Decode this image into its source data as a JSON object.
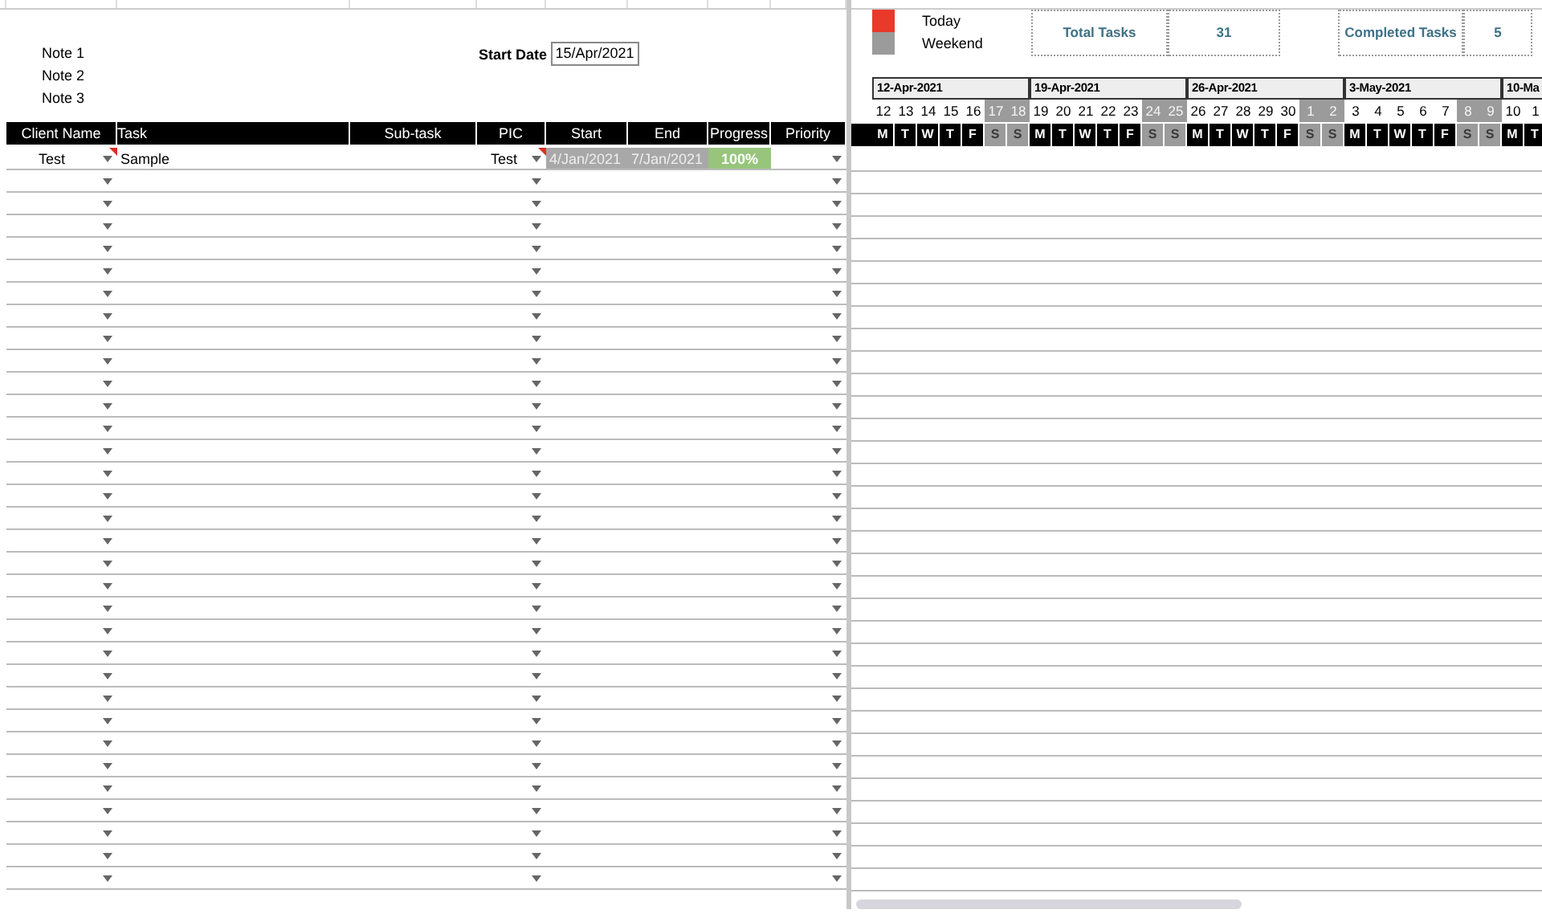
{
  "notes": [
    "Note 1",
    "Note 2",
    "Note 3"
  ],
  "start_date": {
    "label": "Start Date",
    "value": "15/Apr/2021"
  },
  "legend": [
    {
      "label": "Today",
      "color": "#e8392b"
    },
    {
      "label": "Weekend",
      "color": "#9b9b9b"
    }
  ],
  "stats": [
    {
      "label": "Total Tasks",
      "value": "31"
    },
    {
      "label": "Completed Tasks",
      "value": "5"
    }
  ],
  "table": {
    "columns": [
      "Client Name",
      "Task",
      "Sub-task",
      "PIC",
      "Start",
      "End",
      "Progress",
      "Priority"
    ],
    "rows": [
      {
        "kind": "task",
        "client": "Test",
        "client_note": true,
        "task": "Sample",
        "pic": "Test",
        "pic_note": true,
        "start": "4/Jan/2021",
        "end": "7/Jan/2021",
        "progress": "100%"
      },
      {
        "kind": "blank"
      },
      {
        "kind": "blank"
      },
      {
        "kind": "blank"
      },
      {
        "kind": "blank"
      },
      {
        "kind": "blank"
      },
      {
        "kind": "blank"
      },
      {
        "kind": "blank"
      },
      {
        "kind": "blank"
      },
      {
        "kind": "blank"
      },
      {
        "kind": "blank"
      },
      {
        "kind": "blank"
      },
      {
        "kind": "blank"
      },
      {
        "kind": "blank"
      },
      {
        "kind": "blank"
      },
      {
        "kind": "blank"
      },
      {
        "kind": "blank"
      },
      {
        "kind": "blank"
      },
      {
        "kind": "blank"
      },
      {
        "kind": "blank"
      },
      {
        "kind": "blank"
      },
      {
        "kind": "blank"
      },
      {
        "kind": "blank"
      },
      {
        "kind": "blank"
      },
      {
        "kind": "blank"
      },
      {
        "kind": "blank"
      },
      {
        "kind": "blank"
      },
      {
        "kind": "blank"
      },
      {
        "kind": "blank"
      },
      {
        "kind": "blank"
      },
      {
        "kind": "blank"
      },
      {
        "kind": "blank"
      },
      {
        "kind": "blank"
      }
    ]
  },
  "timeline": {
    "weeks": [
      {
        "label": "12-Apr-2021",
        "days": [
          {
            "num": "12",
            "letter": "M",
            "weekend": false
          },
          {
            "num": "13",
            "letter": "T",
            "weekend": false
          },
          {
            "num": "14",
            "letter": "W",
            "weekend": false
          },
          {
            "num": "15",
            "letter": "T",
            "weekend": false
          },
          {
            "num": "16",
            "letter": "F",
            "weekend": false
          },
          {
            "num": "17",
            "letter": "S",
            "weekend": true
          },
          {
            "num": "18",
            "letter": "S",
            "weekend": true
          }
        ]
      },
      {
        "label": "19-Apr-2021",
        "days": [
          {
            "num": "19",
            "letter": "M",
            "weekend": false
          },
          {
            "num": "20",
            "letter": "T",
            "weekend": false
          },
          {
            "num": "21",
            "letter": "W",
            "weekend": false
          },
          {
            "num": "22",
            "letter": "T",
            "weekend": false
          },
          {
            "num": "23",
            "letter": "F",
            "weekend": false
          },
          {
            "num": "24",
            "letter": "S",
            "weekend": true
          },
          {
            "num": "25",
            "letter": "S",
            "weekend": true
          }
        ]
      },
      {
        "label": "26-Apr-2021",
        "days": [
          {
            "num": "26",
            "letter": "M",
            "weekend": false
          },
          {
            "num": "27",
            "letter": "T",
            "weekend": false
          },
          {
            "num": "28",
            "letter": "W",
            "weekend": false
          },
          {
            "num": "29",
            "letter": "T",
            "weekend": false
          },
          {
            "num": "30",
            "letter": "F",
            "weekend": false
          },
          {
            "num": "1",
            "letter": "S",
            "weekend": true
          },
          {
            "num": "2",
            "letter": "S",
            "weekend": true
          }
        ]
      },
      {
        "label": "3-May-2021",
        "days": [
          {
            "num": "3",
            "letter": "M",
            "weekend": false
          },
          {
            "num": "4",
            "letter": "T",
            "weekend": false
          },
          {
            "num": "5",
            "letter": "W",
            "weekend": false
          },
          {
            "num": "6",
            "letter": "T",
            "weekend": false
          },
          {
            "num": "7",
            "letter": "F",
            "weekend": false
          },
          {
            "num": "8",
            "letter": "S",
            "weekend": true
          },
          {
            "num": "9",
            "letter": "S",
            "weekend": true
          }
        ]
      },
      {
        "label": "10-Ma",
        "days": [
          {
            "num": "10",
            "letter": "M",
            "weekend": false
          },
          {
            "num": "1",
            "letter": "T",
            "weekend": false
          }
        ]
      }
    ]
  }
}
